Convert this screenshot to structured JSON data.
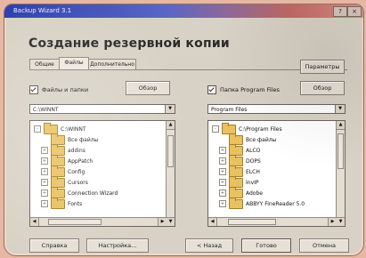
{
  "window": {
    "title": "Backup Wizard 3.1",
    "accent": "#2d3fae"
  },
  "heading": "Создание резервной копии",
  "tabs": [
    {
      "label": "Общие",
      "active": false
    },
    {
      "label": "Файлы",
      "active": true
    },
    {
      "label": "Дополнительно",
      "active": false
    }
  ],
  "top_right_button": "Параметры",
  "left_panel": {
    "checkbox_label": "Файлы и папки",
    "checked": true,
    "side_button": "Обзор",
    "combo_value": "C:\\WINNT",
    "tree": {
      "root": "C:\\WINNT",
      "items": [
        "Все файлы",
        "addins",
        "AppPatch",
        "Config",
        "Cursors",
        "Connection Wizard",
        "Fonts"
      ]
    }
  },
  "right_panel": {
    "checkbox_label": "Папка Program Files",
    "checked": true,
    "side_button": "Обзор",
    "combo_value": "Program Files",
    "tree": {
      "root": "C:\\Program Files",
      "items": [
        "Все файлы",
        "ALCO",
        "DOPS",
        "ELCH",
        "InvIP",
        "Adobe",
        "ABBYY FineReader 5.0"
      ]
    }
  },
  "bottom_buttons": {
    "help": "Справка",
    "settings": "Настройка...",
    "back": "< Назад",
    "ready": "Готово",
    "cancel": "Отмена"
  }
}
